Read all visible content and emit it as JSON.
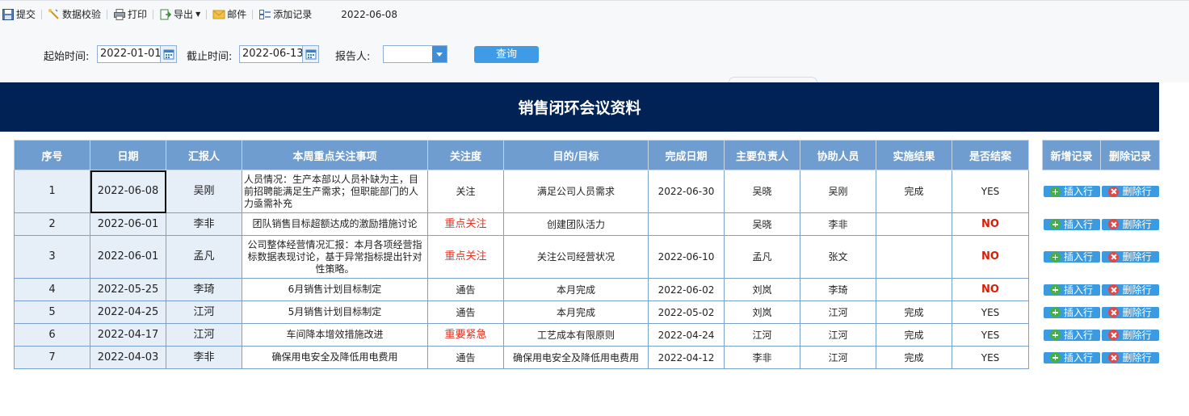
{
  "toolbar": {
    "submit": "提交",
    "validate": "数据校验",
    "print": "打印",
    "export": "导出",
    "mail": "邮件",
    "add_record": "添加记录",
    "current_date": "2022-06-08"
  },
  "query": {
    "start_label": "起始时间:",
    "start_value": "2022-01-01",
    "end_label": "截止时间:",
    "end_value": "2022-06-13",
    "reporter_label": "报告人:",
    "reporter_value": "",
    "search_button": "查询"
  },
  "report_title": "销售闭环会议资料",
  "table": {
    "headers": [
      "序号",
      "日期",
      "汇报人",
      "本周重点关注事项",
      "关注度",
      "目的/目标",
      "完成日期",
      "主要负责人",
      "协助人员",
      "实施结果",
      "是否结案"
    ],
    "rows": [
      {
        "no": "1",
        "date": "2022-06-08",
        "reporter": "吴刚",
        "issue": "人员情况：生产本部以人员补缺为主，目前招聘能满足生产需求；但职能部门的人力亟需补充",
        "attention": "关注",
        "goal": "满足公司人员需求",
        "done_date": "2022-06-30",
        "owner": "吴晓",
        "assist": "吴刚",
        "result": "完成",
        "closed": "YES"
      },
      {
        "no": "2",
        "date": "2022-06-01",
        "reporter": "李非",
        "issue": "团队销售目标超额达成的激励措施讨论",
        "attention": "重点关注",
        "goal": "创建团队活力",
        "done_date": "",
        "owner": "吴晓",
        "assist": "李非",
        "result": "",
        "closed": "NO"
      },
      {
        "no": "3",
        "date": "2022-06-01",
        "reporter": "孟凡",
        "issue": "公司整体经营情况汇报：本月各项经营指标数据表现讨论，基于异常指标提出针对性策略。",
        "attention": "重点关注",
        "goal": "关注公司经营状况",
        "done_date": "2022-06-10",
        "owner": "孟凡",
        "assist": "张文",
        "result": "",
        "closed": "NO"
      },
      {
        "no": "4",
        "date": "2022-05-25",
        "reporter": "李琦",
        "issue": "6月销售计划目标制定",
        "attention": "通告",
        "goal": "本月完成",
        "done_date": "2022-06-02",
        "owner": "刘岚",
        "assist": "李琦",
        "result": "",
        "closed": "NO"
      },
      {
        "no": "5",
        "date": "2022-04-25",
        "reporter": "江河",
        "issue": "5月销售计划目标制定",
        "attention": "通告",
        "goal": "本月完成",
        "done_date": "2022-05-02",
        "owner": "刘岚",
        "assist": "江河",
        "result": "完成",
        "closed": "YES"
      },
      {
        "no": "6",
        "date": "2022-04-17",
        "reporter": "江河",
        "issue": "车间降本增效措施改进",
        "attention": "重要紧急",
        "goal": "工艺成本有限原则",
        "done_date": "2022-04-24",
        "owner": "江河",
        "assist": "江河",
        "result": "完成",
        "closed": "YES"
      },
      {
        "no": "7",
        "date": "2022-04-03",
        "reporter": "李非",
        "issue": "确保用电安全及降低用电费用",
        "attention": "通告",
        "goal": "确保用电安全及降低用电费用",
        "done_date": "2022-04-12",
        "owner": "李非",
        "assist": "江河",
        "result": "完成",
        "closed": "YES"
      }
    ]
  },
  "side": {
    "add_header": "新增记录",
    "del_header": "删除记录",
    "insert_label": "插入行",
    "delete_label": "删除行"
  },
  "colors": {
    "banner": "#002255",
    "header": "#6f9dcf",
    "button": "#3a9be3",
    "highlight_red": "#e03323"
  }
}
